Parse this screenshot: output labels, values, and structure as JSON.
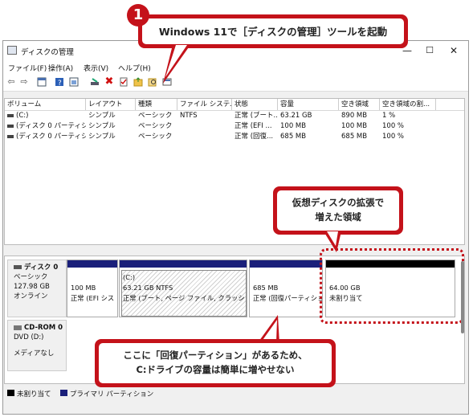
{
  "window": {
    "title": "ディスクの管理"
  },
  "menu": [
    "ファイル(F)",
    "操作(A)",
    "表示(V)",
    "ヘルプ(H)"
  ],
  "toolbar_icons": [
    "back-icon",
    "forward-icon",
    "properties-icon",
    "help-icon",
    "refresh-icon",
    "connect-icon",
    "delete-icon",
    "check-icon",
    "folder-icon",
    "search-icon",
    "console-icon"
  ],
  "columns": [
    "ボリューム",
    "レイアウト",
    "種類",
    "ファイル システム",
    "状態",
    "容量",
    "空き領域",
    "空き領域の割..."
  ],
  "volumes": [
    {
      "name": "(C:)",
      "layout": "シンプル",
      "type": "ベーシック",
      "fs": "NTFS",
      "status": "正常 (ブート...",
      "capacity": "63.21 GB",
      "free": "890 MB",
      "pct": "1 %"
    },
    {
      "name": "(ディスク 0 パーティシ...",
      "layout": "シンプル",
      "type": "ベーシック",
      "fs": "",
      "status": "正常 (EFI ...",
      "capacity": "100 MB",
      "free": "100 MB",
      "pct": "100 %"
    },
    {
      "name": "(ディスク 0 パーティシ...",
      "layout": "シンプル",
      "type": "ベーシック",
      "fs": "",
      "status": "正常 (回復...",
      "capacity": "685 MB",
      "free": "685 MB",
      "pct": "100 %"
    }
  ],
  "disk0": {
    "name": "ディスク 0",
    "type": "ベーシック",
    "size": "127.98 GB",
    "status": "オンライン",
    "partitions": [
      {
        "line1": "",
        "line2": "100 MB",
        "line3": "正常 (EFI シス"
      },
      {
        "line1": "(C:)",
        "line2": "63.21 GB NTFS",
        "line3": "正常 (ブート, ページ ファイル, クラッシュ ダ"
      },
      {
        "line1": "",
        "line2": "685 MB",
        "line3": "正常 (回復パーティショ"
      },
      {
        "line1": "",
        "line2": "64.00 GB",
        "line3": "未割り当て"
      }
    ]
  },
  "cdrom": {
    "name": "CD-ROM 0",
    "drive": "DVD (D:)",
    "media": "メディアなし"
  },
  "legend": {
    "unallocated": "未割り当て",
    "primary": "プライマリ パーティション"
  },
  "callouts": {
    "badge": "1",
    "top": "Windows 11で［ディスクの管理］ツールを起動",
    "right_line1": "仮想ディスクの拡張で",
    "right_line2": "増えた領域",
    "bottom_line1": "ここに「回復パーティション」があるため、",
    "bottom_line2": "C:ドライブの容量は簡単に増やせない"
  },
  "colors": {
    "accent": "#c4121a",
    "primary_partition": "#1a1f7a",
    "unallocated": "#000000"
  }
}
